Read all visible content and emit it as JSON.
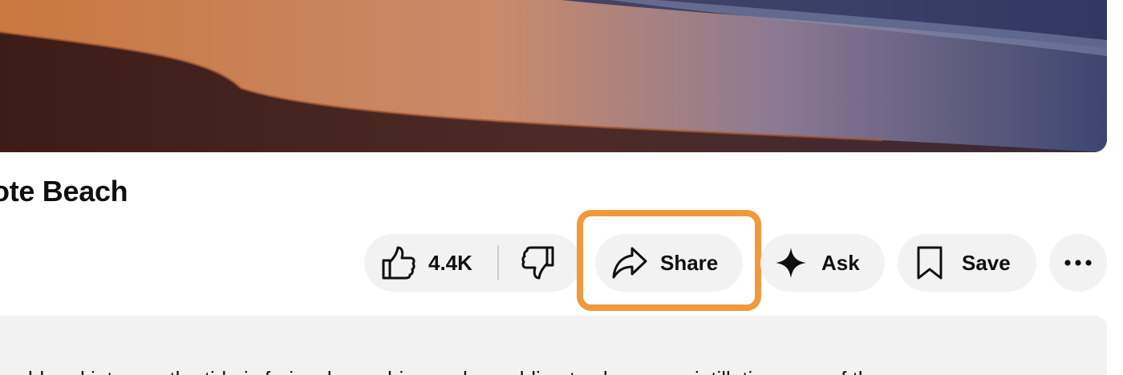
{
  "video": {
    "thumbnail": "sunset-beach-image"
  },
  "title": "ote Beach",
  "actions": {
    "like_count": "4.4K",
    "share_label": "Share",
    "ask_label": "Ask",
    "save_label": "Save"
  },
  "highlight_color": "#f0993a",
  "description": {
    "text": "ld and intense, the tide is furiously crashing and crumbling to shore, a scintillating rape of the"
  }
}
